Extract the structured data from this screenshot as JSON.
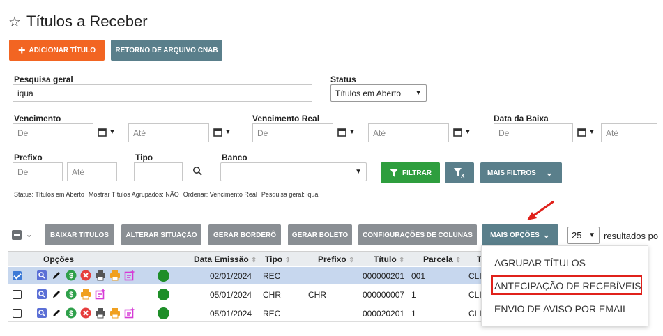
{
  "page": {
    "title": "Títulos a Receber"
  },
  "toolbar": {
    "add_label": "ADICIONAR TÍTULO",
    "cnab_label": "RETORNO DE ARQUIVO CNAB"
  },
  "filters": {
    "search_label": "Pesquisa geral",
    "search_value": "iqua",
    "status_label": "Status",
    "status_value": "Títulos em Aberto",
    "venc_label": "Vencimento",
    "venc_real_label": "Vencimento Real",
    "baixa_label": "Data da Baixa",
    "de_ph": "De",
    "ate_ph": "Até",
    "prefixo_label": "Prefixo",
    "tipo_label": "Tipo",
    "banco_label": "Banco",
    "filtrar_label": "FILTRAR",
    "mais_filtros_label": "MAIS FILTROS"
  },
  "chips": [
    "Status: Títulos em Aberto",
    "Mostrar Títulos Agrupados: NÃO",
    "Ordenar: Vencimento Real",
    "Pesquisa geral: iqua"
  ],
  "actions": {
    "baixar": "BAIXAR TÍTULOS",
    "alterar": "ALTERAR SITUAÇÃO",
    "bordero": "GERAR BORDERÔ",
    "boleto": "GERAR BOLETO",
    "config": "CONFIGURAÇÕES DE COLUNAS",
    "mais": "MAIS OPÇÕES",
    "per_page": "25",
    "per_page_text": "resultados po"
  },
  "table": {
    "headers": [
      "Opções",
      "Data Emissão",
      "Tipo",
      "Prefixo",
      "Título",
      "Parcela",
      "T"
    ],
    "rows": [
      {
        "data": "02/01/2024",
        "tipo": "REC",
        "prefixo": "",
        "titulo": "000000201",
        "parcela": "001",
        "t": "CLI",
        "selected": true
      },
      {
        "data": "05/01/2024",
        "tipo": "CHR",
        "prefixo": "CHR",
        "titulo": "000000007",
        "parcela": "1",
        "t": "CLI",
        "selected": false
      },
      {
        "data": "05/01/2024",
        "tipo": "REC",
        "prefixo": "",
        "titulo": "000020201",
        "parcela": "1",
        "t": "CLI",
        "selected": false
      }
    ]
  },
  "menu": {
    "items": [
      "AGRUPAR TÍTULOS",
      "ANTECIPAÇÃO DE RECEBÍVEIS",
      "ENVIO DE AVISO POR EMAIL"
    ]
  },
  "colors": {
    "orange": "#f26522",
    "slate": "#5a7f8b",
    "green": "#2e9e3e",
    "highlight": "#e0211b"
  }
}
